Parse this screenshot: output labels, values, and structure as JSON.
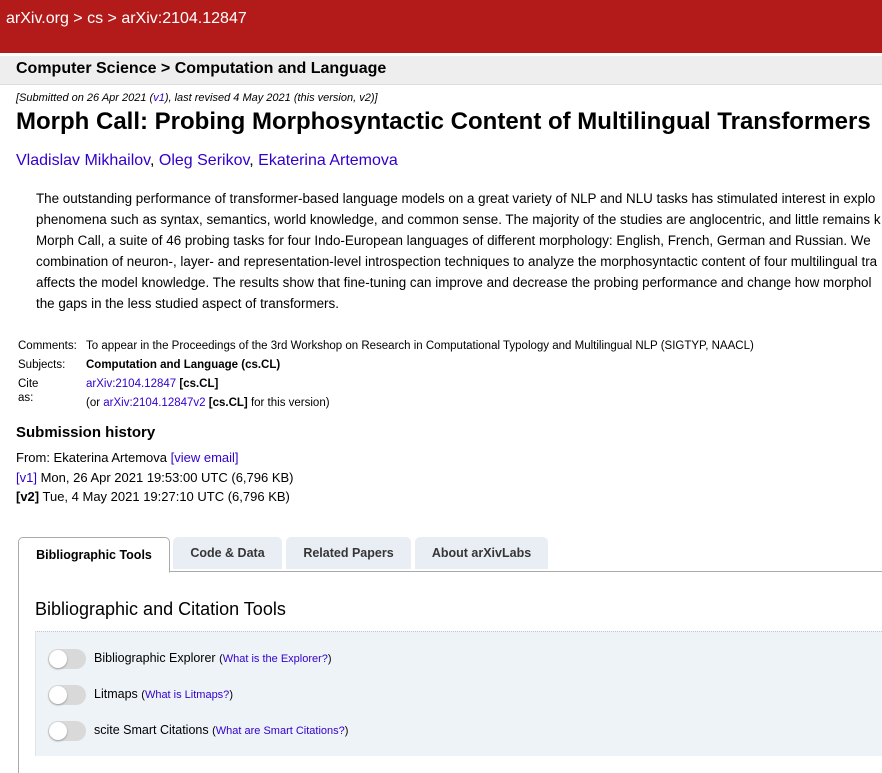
{
  "breadcrumb": {
    "site": "arXiv.org",
    "sep1": " > ",
    "section": "cs",
    "sep2": " > ",
    "id": "arXiv:2104.12847"
  },
  "subheader": "Computer Science > Computation and Language",
  "dateline": {
    "pre": "[Submitted on 26 Apr 2021 (",
    "v1": "v1",
    "post": "), last revised 4 May 2021 (this version, v2)]"
  },
  "title": "Morph Call: Probing Morphosyntactic Content of Multilingual Transformers",
  "authors": [
    "Vladislav Mikhailov",
    "Oleg Serikov",
    "Ekaterina Artemova"
  ],
  "author_sep": ", ",
  "abstract_lines": [
    "The outstanding performance of transformer-based language models on a great variety of NLP and NLU tasks has stimulated interest in explo",
    "phenomena such as syntax, semantics, world knowledge, and common sense. The majority of the studies are anglocentric, and little remains k",
    "Morph Call, a suite of 46 probing tasks for four Indo-European languages of different morphology: English, French, German and Russian. We",
    "combination of neuron-, layer- and representation-level introspection techniques to analyze the morphosyntactic content of four multilingual tra",
    "affects the model knowledge. The results show that fine-tuning can improve and decrease the probing performance and change how morphol",
    "the gaps in the less studied aspect of transformers."
  ],
  "meta": {
    "comments_label": "Comments:",
    "comments": "To appear in the Proceedings of the 3rd Workshop on Research in Computational Typology and Multilingual NLP (SIGTYP, NAACL)",
    "subjects_label": "Subjects:",
    "subjects": "Computation and Language (cs.CL)",
    "cite_label": "Cite as:",
    "cite_link": "arXiv:2104.12847",
    "cite_tag": "[cs.CL]",
    "cite2_pre": "(or ",
    "cite2_link": "arXiv:2104.12847v2",
    "cite2_tag": "[cs.CL]",
    "cite2_post": " for this version)"
  },
  "history": {
    "heading": "Submission history",
    "from_pre": "From: Ekaterina Artemova ",
    "view_email": "[view email]",
    "versions": [
      {
        "label": "[v1]",
        "text": " Mon, 26 Apr 2021 19:53:00 UTC (6,796 KB)"
      },
      {
        "label": "[v2]",
        "text": " Tue, 4 May 2021 19:27:10 UTC (6,796 KB)"
      }
    ]
  },
  "tabs": [
    "Bibliographic Tools",
    "Code & Data",
    "Related Papers",
    "About arXivLabs"
  ],
  "panel": {
    "heading": "Bibliographic and Citation Tools",
    "tools": [
      {
        "name": "Bibliographic Explorer",
        "help": "What is the Explorer?"
      },
      {
        "name": "Litmaps",
        "help": "What is Litmaps?"
      },
      {
        "name": "scite Smart Citations",
        "help": "What are Smart Citations?"
      }
    ]
  }
}
